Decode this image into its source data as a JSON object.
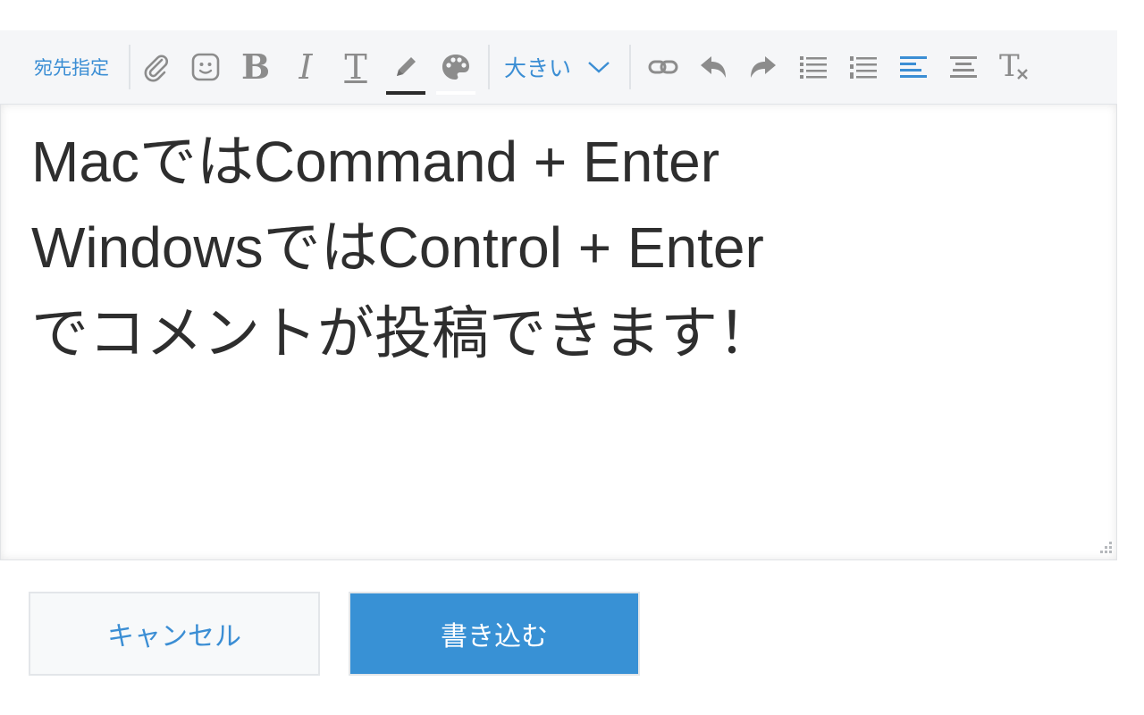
{
  "toolbar": {
    "mention_label": "宛先指定",
    "bold_glyph": "B",
    "italic_glyph": "I",
    "textstyle_glyph": "T",
    "clear_format_glyph": "T",
    "font_size_label": "大きい",
    "font_color": "#2b2b2b",
    "background_color": "#ffffff",
    "active_color": "#3b8ed4",
    "icon_color": "#8c8c8c"
  },
  "content": {
    "lines": [
      "MacではCommand + Enter",
      "WindowsではControl + Enter",
      "でコメントが投稿できます！"
    ]
  },
  "buttons": {
    "cancel_label": "キャンセル",
    "submit_label": "書き込む"
  }
}
